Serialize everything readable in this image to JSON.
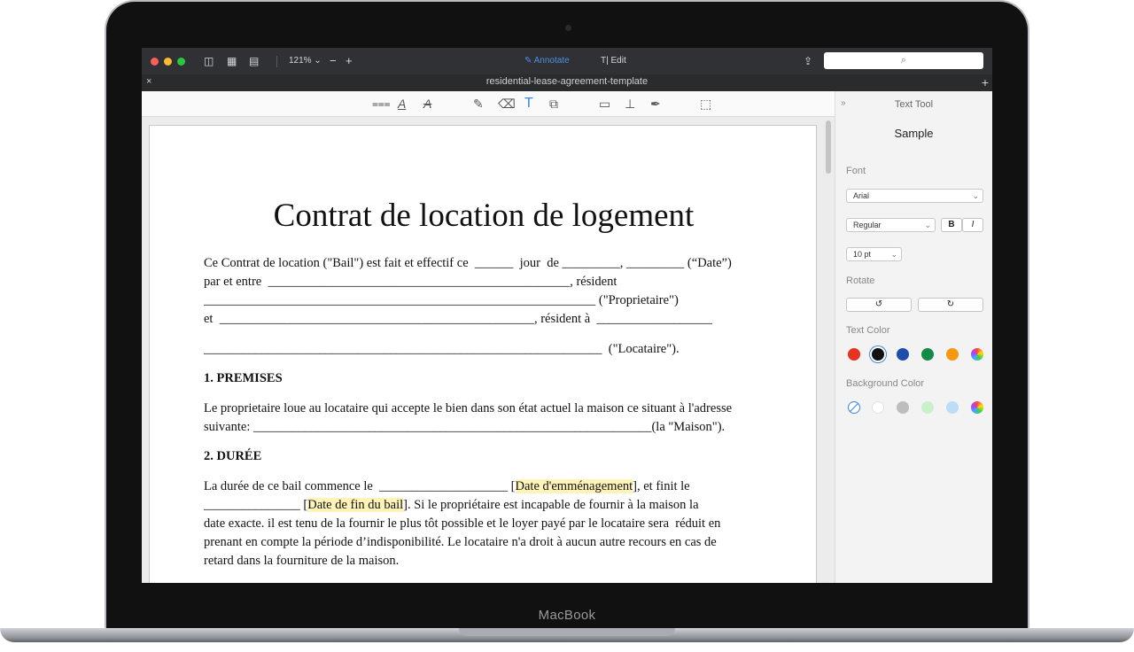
{
  "device": {
    "brand": "MacBook"
  },
  "toolbar": {
    "zoom": "121%",
    "zoom_out": "−",
    "zoom_in": "+",
    "annotate": "Annotate",
    "edit": "Edit"
  },
  "tab": {
    "title": "residential-lease-agreement-template",
    "close": "×",
    "add": "+"
  },
  "doc": {
    "title": "Contrat de location de logement",
    "p1": [
      "Ce Contrat de location (\"Bail\") est fait et effectif ce  ______  jour  de _________, _________ (“Date”)",
      "par et entre  _______________________________________________, résident",
      "_____________________________________________________________ (\"Proprietaire\")",
      "et  _________________________________________________, résident à  __________________",
      "______________________________________________________________  (\"Locataire\")."
    ],
    "h_premises": "1. PREMISES",
    "premises": [
      "Le proprietaire loue au locataire qui accepte le bien dans son état actuel la maison ce situant à l'adresse",
      "suivante: ______________________________________________________________(la \"Maison\")."
    ],
    "h_duree": "2. DURÉE",
    "duree_a": "La durée de ce bail commence le  ____________________ [",
    "duree_hl1": "Date d'emménagement",
    "duree_b": "], et finit le",
    "duree2_a": "_______________ [",
    "duree_hl2": "Date de fin du bail",
    "duree2_b": "]. Si le propriétaire est incapable de fournir à la maison la",
    "duree_rest": [
      "date exacte. il est tenu de la fournir le plus tôt possible et le loyer payé par le locataire sera  réduit en",
      "prenant en compte la période d’indisponibilité. Le locataire n'a droit à aucun autre recours en cas de",
      "retard dans la fourniture de la maison."
    ]
  },
  "panel": {
    "title": "Text Tool",
    "sample": "Sample",
    "font_label": "Font",
    "font": "Arial",
    "style": "Regular",
    "bold": "B",
    "italic": "I",
    "size": "10 pt",
    "rotate_label": "Rotate",
    "text_color_label": "Text Color",
    "bg_color_label": "Background Color",
    "text_colors": [
      "#e8321f",
      "#111111",
      "#1e4fa8",
      "#13894a",
      "#f59a0f"
    ],
    "bg_colors": [
      "#ffffff",
      "#bdbdbd",
      "#c9f0c9",
      "#bcdcf7"
    ]
  }
}
